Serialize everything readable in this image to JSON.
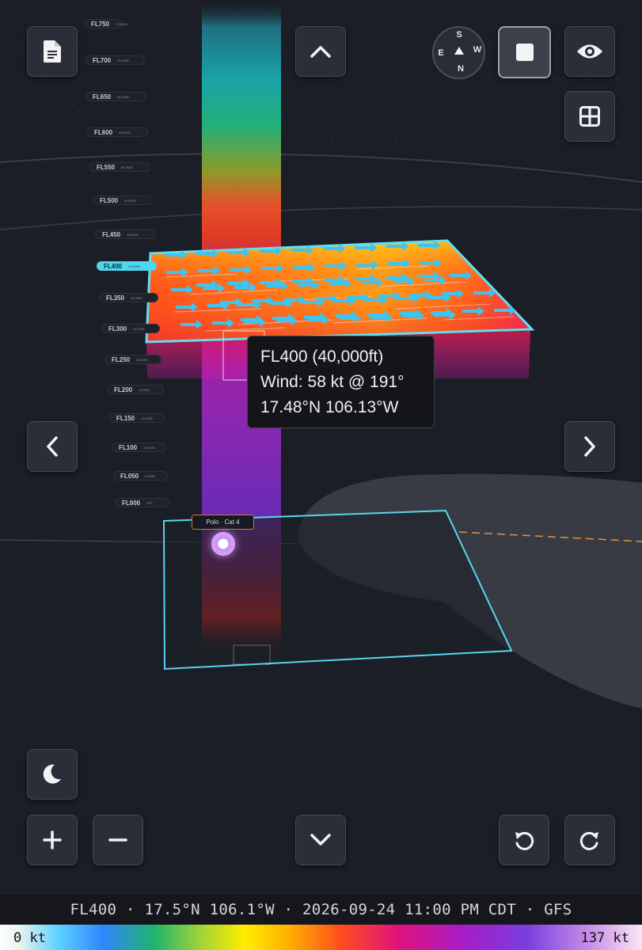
{
  "flight_levels": [
    {
      "label": "FL750",
      "sub": "75,000ft"
    },
    {
      "label": "FL700",
      "sub": "70,000ft"
    },
    {
      "label": "FL650",
      "sub": "65,000ft"
    },
    {
      "label": "FL600",
      "sub": "60,000ft"
    },
    {
      "label": "FL550",
      "sub": "55,000ft"
    },
    {
      "label": "FL500",
      "sub": "50,000ft"
    },
    {
      "label": "FL450",
      "sub": "45,000ft"
    },
    {
      "label": "FL400",
      "sub": "40,000ft"
    },
    {
      "label": "FL350",
      "sub": "35,000ft"
    },
    {
      "label": "FL300",
      "sub": "30,000ft"
    },
    {
      "label": "FL250",
      "sub": "25,000ft"
    },
    {
      "label": "FL200",
      "sub": "20,000ft"
    },
    {
      "label": "FL150",
      "sub": "15,000ft"
    },
    {
      "label": "FL100",
      "sub": "10,000ft"
    },
    {
      "label": "FL050",
      "sub": "5,000ft"
    },
    {
      "label": "FL000",
      "sub": "SFC"
    }
  ],
  "selected_level": "FL400",
  "tooltip": {
    "line1": "FL400 (40,000ft)",
    "line2": "Wind: 58 kt @ 191°",
    "line3": "17.48°N 106.13°W"
  },
  "storm": {
    "label": "Polo · Cat 4"
  },
  "compass": {
    "n": "N",
    "s": "S",
    "e": "E",
    "w": "W"
  },
  "status_bar": {
    "text": "FL400 · 17.5°N 106.1°W · 2026-09-24 11:00 PM CDT · GFS"
  },
  "legend": {
    "min_label": "0 kt",
    "max_label": "137 kt"
  },
  "icons": {
    "document": "document-icon",
    "up": "chevron-up-icon",
    "down": "chevron-down-icon",
    "left": "chevron-left-icon",
    "right": "chevron-right-icon",
    "stop": "square-icon",
    "eye": "eye-icon",
    "grid": "grid-icon",
    "moon": "moon-icon",
    "plus": "plus-icon",
    "minus": "minus-icon",
    "undo": "rotate-ccw-icon",
    "redo": "rotate-cw-icon"
  },
  "colors": {
    "accent": "#4dd6ee",
    "storm_outline": "#d07a2c",
    "background": "#1b1e27"
  }
}
